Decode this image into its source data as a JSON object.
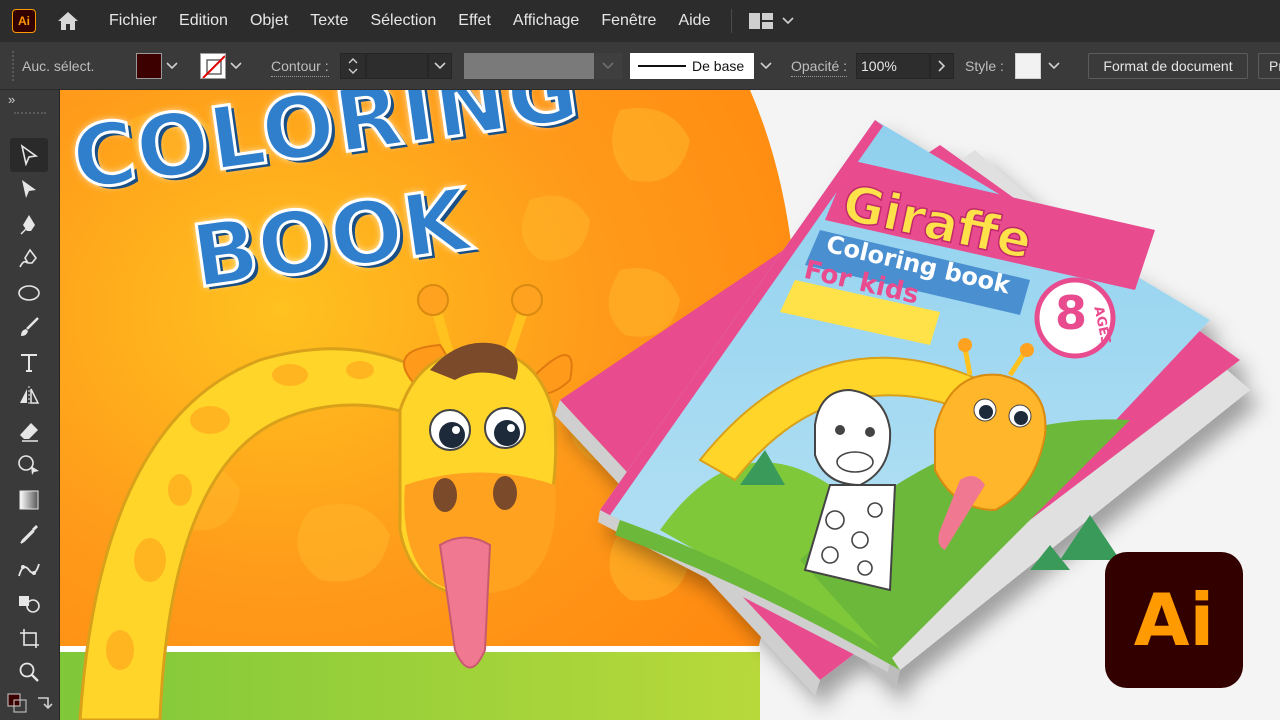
{
  "app": {
    "badge": "Ai",
    "menu": [
      "Fichier",
      "Edition",
      "Objet",
      "Texte",
      "Sélection",
      "Effet",
      "Affichage",
      "Fenêtre",
      "Aide"
    ]
  },
  "controlbar": {
    "selection_status": "Auc. sélect.",
    "contour_label": "Contour :",
    "stroke_profile": "De base",
    "opacity_label": "Opacité :",
    "opacity_value": "100%",
    "style_label": "Style :",
    "document_button": "Format de document",
    "overflow_button": "Pr",
    "fill_color": "#3d0000"
  },
  "toolbar": {
    "collapse": "»",
    "tools": [
      "selection-tool",
      "direct-selection-tool",
      "pen-tool",
      "curvature-tool",
      "ellipse-tool",
      "paintbrush-tool",
      "type-tool",
      "reflect-tool",
      "eraser-tool",
      "shape-builder-tool",
      "gradient-tool",
      "eyedropper-tool",
      "puppet-warp-tool",
      "live-paint-tool",
      "artboard-tool",
      "zoom-tool"
    ]
  },
  "artwork": {
    "headline_line1": "COLORING",
    "headline_line2": "BOOK",
    "cover": {
      "title": "Giraffe",
      "subtitle": "Coloring book",
      "audience": "For kids",
      "age_number": "8",
      "age_label": "AGES"
    },
    "logo": "Ai"
  },
  "colors": {
    "accent_orange": "#ff9a00",
    "headline_blue": "#2f7fcc",
    "cover_pink": "#e94b8f",
    "cover_sky": "#8fd0ee"
  }
}
